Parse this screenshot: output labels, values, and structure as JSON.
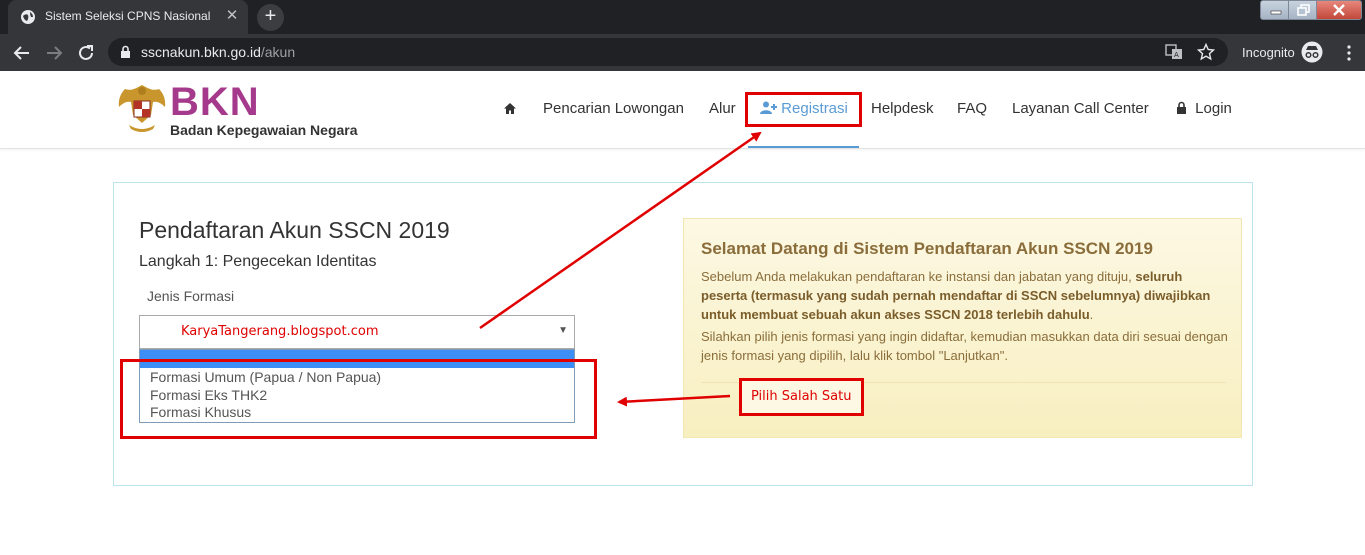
{
  "browser": {
    "tab_title": "Sistem Seleksi CPNS Nasional",
    "url_host": "sscnakun.bkn.go.id",
    "url_path": "/akun",
    "profile_label": "Incognito"
  },
  "header": {
    "logo_text": "BKN",
    "logo_subtitle": "Badan Kepegawaian Negara",
    "nav": {
      "search": "Pencarian Lowongan",
      "flow": "Alur",
      "register": "Registrasi",
      "helpdesk": "Helpdesk",
      "faq": "FAQ",
      "callcenter": "Layanan Call Center",
      "login": "Login"
    }
  },
  "form": {
    "title": "Pendaftaran Akun SSCN 2019",
    "step": "Langkah 1: Pengecekan Identitas",
    "field_label": "Jenis Formasi",
    "select_value": "KaryaTangerang.blogspot.com",
    "options": [
      "Formasi Umum (Papua / Non Papua)",
      "Formasi Eks THK2",
      "Formasi Khusus"
    ]
  },
  "welcome": {
    "title": "Selamat Datang di Sistem Pendaftaran Akun SSCN 2019",
    "p1_plain": "Sebelum Anda melakukan pendaftaran ke instansi dan jabatan yang dituju, ",
    "p1_bold_1": "seluruh",
    "p1_bold_2": "peserta (termasuk yang sudah pernah mendaftar di SSCN sebelumnya) diwajibkan",
    "p1_bold_3": "untuk membuat sebuah akun akses SSCN 2018 terlebih dahulu",
    "p1_end": ".",
    "p2": "Silahkan pilih jenis formasi yang ingin didaftar, kemudian masukkan data diri sesuai dengan jenis formasi yang dipilih, lalu klik tombol \"Lanjutkan\"."
  },
  "annotation": {
    "pick_label": "Pilih Salah Satu",
    "color": "#e00000"
  }
}
